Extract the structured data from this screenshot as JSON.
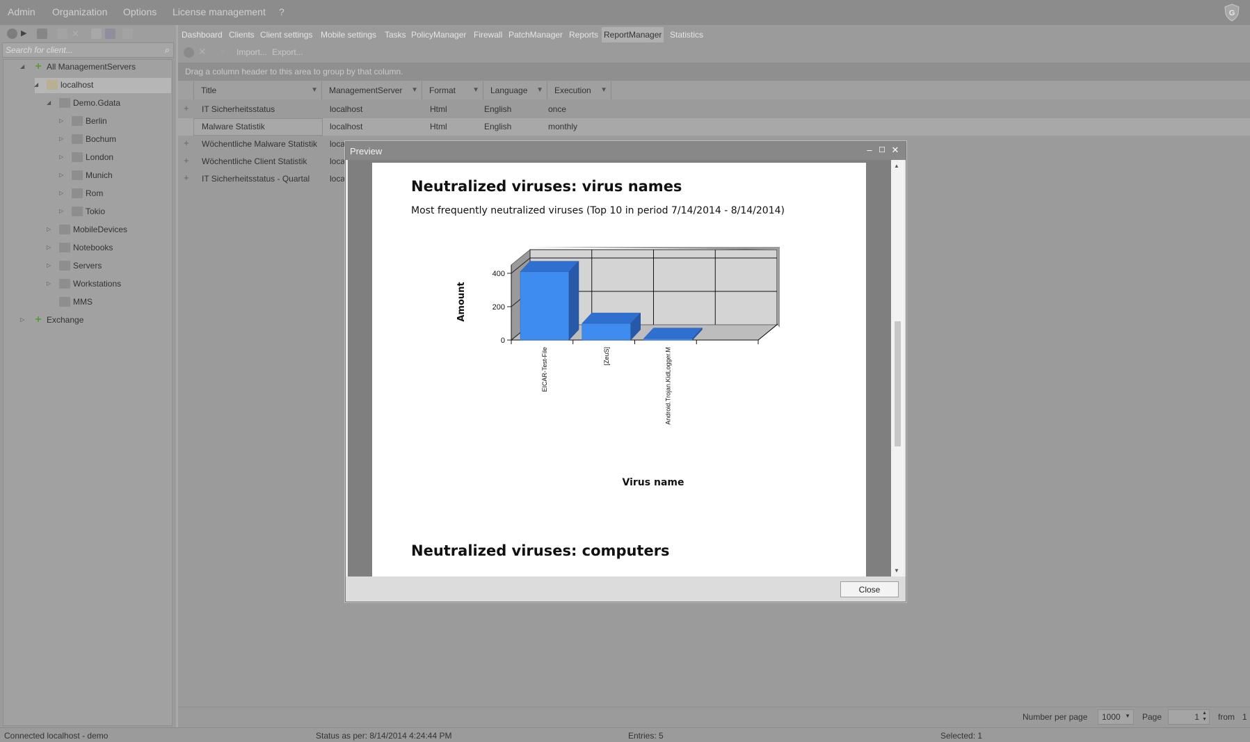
{
  "menu": [
    "Admin",
    "Organization",
    "Options",
    "License management",
    "?"
  ],
  "search": {
    "placeholder": "Search for client..."
  },
  "tree": [
    {
      "label": "All ManagementServers",
      "level": 0
    },
    {
      "label": "localhost",
      "level": 1
    },
    {
      "label": "Demo.Gdata",
      "level": 2
    },
    {
      "label": "Berlin",
      "level": 3
    },
    {
      "label": "Bochum",
      "level": 3
    },
    {
      "label": "London",
      "level": 3
    },
    {
      "label": "Munich",
      "level": 3
    },
    {
      "label": "Rom",
      "level": 3
    },
    {
      "label": "Tokio",
      "level": 3
    },
    {
      "label": "MobileDevices",
      "level": 2
    },
    {
      "label": "Notebooks",
      "level": 2
    },
    {
      "label": "Servers",
      "level": 2
    },
    {
      "label": "Workstations",
      "level": 2
    },
    {
      "label": "MMS",
      "level": 2
    },
    {
      "label": "Exchange",
      "level": 0
    }
  ],
  "tabs": [
    "Dashboard",
    "Clients",
    "Client settings",
    "Mobile settings",
    "Tasks",
    "PolicyManager",
    "Firewall",
    "PatchManager",
    "Reports",
    "ReportManager",
    "Statistics"
  ],
  "active_tab": "ReportManager",
  "toolbar": {
    "import": "Import...",
    "export": "Export..."
  },
  "group_hint": "Drag a column header to this area to group by that column.",
  "grid": {
    "columns": [
      "Title",
      "ManagementServer",
      "Format",
      "Language",
      "Execution"
    ],
    "rows": [
      [
        "IT Sicherheitsstatus",
        "localhost",
        "Html",
        "English",
        "once"
      ],
      [
        "Malware Statistik",
        "localhost",
        "Html",
        "English",
        "monthly"
      ],
      [
        "Wöchentliche Malware Statistik",
        "loca",
        "",
        "",
        ""
      ],
      [
        "Wöchentliche Client Statistik",
        "loca",
        "",
        "",
        ""
      ],
      [
        "IT Sicherheitsstatus - Quartal",
        "loca",
        "",
        "",
        ""
      ]
    ]
  },
  "pager": {
    "number_per_page_label": "Number per page",
    "number_per_page": "1000",
    "page_label": "Page",
    "page": "1",
    "from_label": "from",
    "from": "1"
  },
  "status": {
    "connected": "Connected localhost - demo",
    "status_as_per": "Status as per: 8/14/2014 4:24:44 PM",
    "entries": "Entries: 5",
    "selected": "Selected: 1"
  },
  "dialog": {
    "title": "Preview",
    "heading1": "Neutralized viruses: virus names",
    "subtitle": "Most frequently neutralized viruses (Top 10 in period 7/14/2014 - 8/14/2014)",
    "heading2": "Neutralized viruses: computers",
    "close_label": "Close"
  },
  "chart_data": {
    "type": "bar",
    "categories": [
      "EICAR-Test-File",
      "[ZeuS]",
      "Android.Trojan.KidLogger.M"
    ],
    "values": [
      410,
      100,
      10
    ],
    "xlabel": "Virus name",
    "ylabel": "Amount",
    "yticks": [
      0,
      200,
      400
    ],
    "ylim": [
      0,
      450
    ],
    "bar_color": "#3f8cf0",
    "grid": true,
    "style": "3d"
  }
}
